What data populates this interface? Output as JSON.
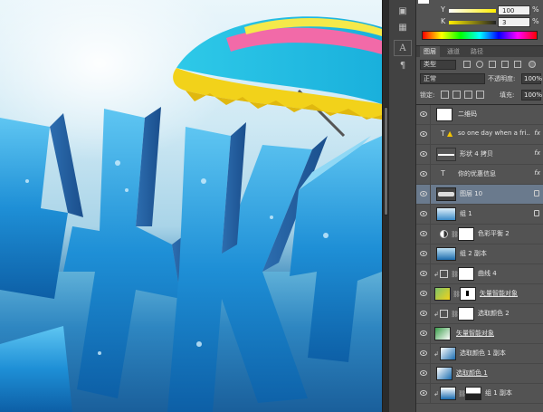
{
  "color_panel": {
    "y_label": "Y",
    "y_value": "100",
    "k_label": "K",
    "k_value": "3",
    "unit": "%"
  },
  "layers_panel": {
    "tabs": [
      "图层",
      "通道",
      "路径"
    ],
    "active_tab": "图层",
    "filter_kind": "类型",
    "blend_mode": "正常",
    "opacity_label": "不透明度:",
    "opacity_value": "100%",
    "lock_label": "锁定:",
    "fill_label": "填充:",
    "fill_value": "100%",
    "layers": [
      {
        "name": "二维码",
        "type": "image",
        "fx": false,
        "lock": false
      },
      {
        "name": "so one day when a fri...",
        "type": "text",
        "fx": true,
        "warning": true
      },
      {
        "name": "形状 4 拷贝",
        "type": "shape",
        "fx": true
      },
      {
        "name": "你的优惠信息",
        "type": "text",
        "fx": true
      },
      {
        "name": "图层 10",
        "type": "image",
        "selected": true,
        "lock": true
      },
      {
        "name": "组 1",
        "type": "group",
        "lock": true
      },
      {
        "name": "色彩平衡 2",
        "type": "adjustment"
      },
      {
        "name": "组 2 副本",
        "type": "group"
      },
      {
        "name": "曲线 4",
        "type": "adjustment"
      },
      {
        "name": "矢量智能对象",
        "type": "smart"
      },
      {
        "name": "选取颜色 2",
        "type": "adjustment"
      },
      {
        "name": "矢量智能对象",
        "type": "smart"
      },
      {
        "name": "选取颜色 1 副本",
        "type": "adjustment"
      },
      {
        "name": "选取颜色 1",
        "type": "adjustment"
      },
      {
        "name": "组 1 副本",
        "type": "adjustment"
      }
    ]
  },
  "colors": {
    "panel_bg": "#535353",
    "selected_row": "#6a7a8d",
    "text": "#e6e6e6"
  },
  "icons": [
    "eye-icon",
    "chain-icon",
    "folder-icon",
    "lock-icon",
    "fx-icon",
    "warning-icon",
    "text-tool-icon",
    "paragraph-icon"
  ]
}
